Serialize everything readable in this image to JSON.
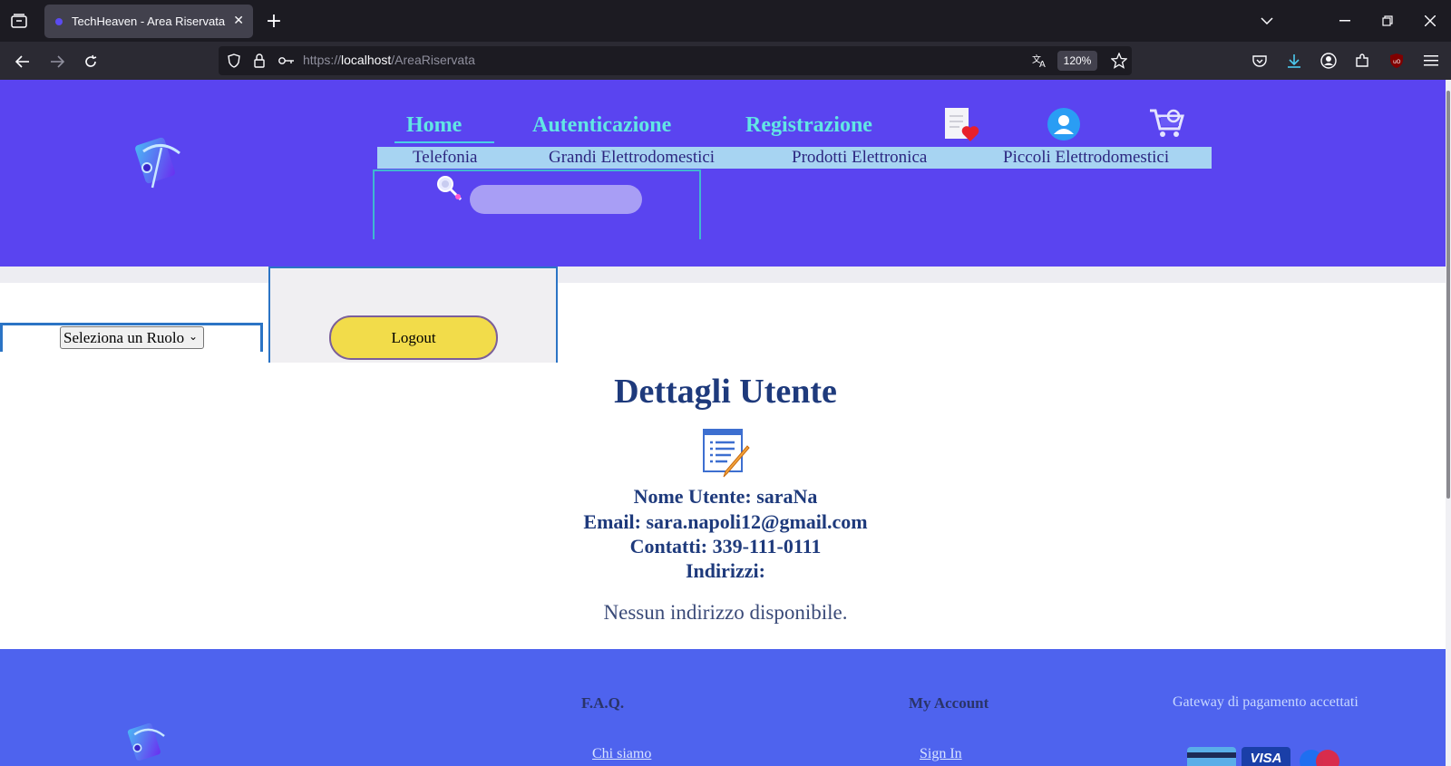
{
  "browser": {
    "tab_title": "TechHeaven - Area Riservata",
    "tab_close": "✕",
    "new_tab": "+",
    "url_prefix": "https://",
    "url_host": "localhost",
    "url_path": "/AreaRiservata",
    "zoom": "120%"
  },
  "header": {
    "nav": [
      "Home",
      "Autenticazione",
      "Registrazione"
    ],
    "categories": [
      "Telefonia",
      "Grandi Elettrodomestici",
      "Prodotti Elettronica",
      "Piccoli Elettrodomestici"
    ],
    "search_placeholder": ""
  },
  "sidebar": {
    "role_select": "Seleziona un Ruolo",
    "logout": "Logout"
  },
  "details": {
    "title": "Dettagli Utente",
    "username": "Nome Utente: saraNa",
    "email": "Email: sara.napoli12@gmail.com",
    "contacts": "Contatti: 339-111-0111",
    "addresses_label": "Indirizzi:",
    "no_address": "Nessun indirizzo disponibile."
  },
  "footer": {
    "faq": "F.A.Q.",
    "my_account": "My Account",
    "gateway": "Gateway di pagamento accettati",
    "about": "Chi siamo",
    "sign_in": "Sign In"
  },
  "colors": {
    "header_bg": "#5a44f0",
    "nav_link": "#62e6e4",
    "footer_bg": "#4e63ee",
    "title_text": "#1e3a7c",
    "logout_btn": "#f2dc4a"
  }
}
